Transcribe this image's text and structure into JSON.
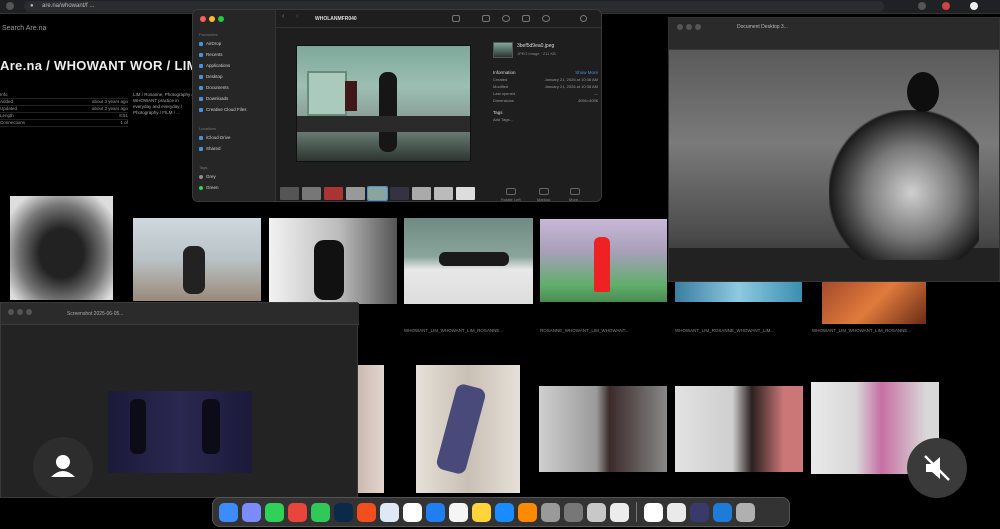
{
  "browser": {
    "url": "are.na/whowant/f ..."
  },
  "arena": {
    "search": "Search Are.na",
    "title": "Are.na / WHOWANT WOR / LIM",
    "meta_rows": [
      {
        "k": "Info",
        "v": ""
      },
      {
        "k": "Added",
        "v": "about 3 years ago"
      },
      {
        "k": "Updated",
        "v": "about 3 years ago"
      },
      {
        "k": "Length",
        "v": "8:51"
      },
      {
        "k": "Connections",
        "v": "1 of"
      }
    ],
    "description": "LIM / Rosanne, Photography / WHOWANT practice in everyday and everyday / Photography / FILM / ...",
    "captions": [
      "WHOWANT_LIM_WHOWANT_LIM_ROSANNE...",
      "ROSANNE_WHOWANT_LIM_WHOWANT...",
      "WHOWANT_LIM_ROSANNE_WHOWANT_LIM..."
    ]
  },
  "finder": {
    "title": "WHOLANMFR040",
    "sidebar_header_fav": "Favourites",
    "sidebar_items": [
      {
        "label": "AirDrop",
        "color": "#4a90d9"
      },
      {
        "label": "Recents",
        "color": "#4a90d9"
      },
      {
        "label": "Applications",
        "color": "#4a90d9"
      },
      {
        "label": "Desktop",
        "color": "#4a90d9"
      },
      {
        "label": "Documents",
        "color": "#4a90d9"
      },
      {
        "label": "Downloads",
        "color": "#4a90d9"
      },
      {
        "label": "Creative Cloud Files",
        "color": "#4a90d9"
      }
    ],
    "sidebar_header_loc": "Locations",
    "locations": [
      {
        "label": "iCloud Drive",
        "color": "#4a90d9"
      },
      {
        "label": "Shared",
        "color": "#4a90d9"
      }
    ],
    "sidebar_header_tags": "Tags",
    "tags": [
      {
        "label": "Grey",
        "color": "#8e8e93"
      },
      {
        "label": "Green",
        "color": "#30d158"
      }
    ],
    "file_name": "3bef5d9ea0.jpeg",
    "file_kind": "JPEG image · 211 KB",
    "info_header": "Information",
    "info_more": "Show More",
    "info_rows": [
      {
        "k": "Created",
        "v": "January 21, 2026 at 10:38 AM"
      },
      {
        "k": "Modified",
        "v": "January 21, 2026 at 10:38 AM"
      },
      {
        "k": "Last opened",
        "v": "—"
      },
      {
        "k": "Dimensions",
        "v": "4096×4096"
      }
    ],
    "tags_header": "Tags",
    "add_tags": "Add Tags...",
    "actions": [
      "Rotate Left",
      "Markup",
      "More..."
    ]
  },
  "preview": {
    "title": "Document Desktop 3..."
  },
  "recording": {
    "title": "Screenshot 2025-06-05..."
  },
  "icons": {
    "avatar": "person-icon",
    "mute": "speaker-muted-icon"
  },
  "dock": {
    "apps": [
      {
        "name": "finder",
        "color": "#3d8bfd"
      },
      {
        "name": "launchpad",
        "color": "#7a8cff"
      },
      {
        "name": "messages",
        "color": "#2fd158"
      },
      {
        "name": "chrome",
        "color": "#e8453c"
      },
      {
        "name": "facetime",
        "color": "#31c85a"
      },
      {
        "name": "photoshop",
        "color": "#0b2a4a"
      },
      {
        "name": "figma",
        "color": "#f24e1e"
      },
      {
        "name": "safari",
        "color": "#dfe8f5"
      },
      {
        "name": "calendar",
        "color": "#ffffff"
      },
      {
        "name": "mail",
        "color": "#1f7ef0"
      },
      {
        "name": "notes",
        "color": "#f5f5f5"
      },
      {
        "name": "stickies",
        "color": "#ffd43b"
      },
      {
        "name": "appstore",
        "color": "#1a8cff"
      },
      {
        "name": "vlc",
        "color": "#ff8a00"
      },
      {
        "name": "settings",
        "color": "#9a9a9a"
      },
      {
        "name": "utility",
        "color": "#777777"
      },
      {
        "name": "preview",
        "color": "#c8c8c8"
      },
      {
        "name": "textedit",
        "color": "#ececec"
      }
    ],
    "recent": [
      {
        "name": "screenshot-thumb",
        "color": "#ffffff"
      },
      {
        "name": "doc-thumb",
        "color": "#eaeaea"
      },
      {
        "name": "image-thumb",
        "color": "#3a3a6a"
      },
      {
        "name": "folder",
        "color": "#1e7bd8"
      },
      {
        "name": "trash",
        "color": "#b0b0b0"
      }
    ]
  }
}
